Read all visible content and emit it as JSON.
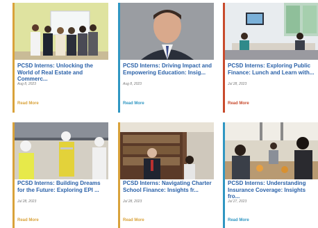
{
  "cards": [
    {
      "title": "PCSD Interns: Unlocking the World of Real Estate and Commerc...",
      "date": "Aug 8, 2023",
      "read_more": "Read More",
      "accent": "#d9a23a"
    },
    {
      "title": "PCSD Interns: Driving Impact and Empowering Education: Insig...",
      "date": "Aug 8, 2023",
      "read_more": "Read More",
      "accent": "#2f96c2"
    },
    {
      "title": "PCSD Interns: Exploring Public Finance: Lunch and Learn with...",
      "date": "Jul 28, 2023",
      "read_more": "Read More",
      "accent": "#c84a2c"
    },
    {
      "title": "PCSD Interns: Building Dreams for the Future: Exploring EPI ...",
      "date": "Jul 28, 2023",
      "read_more": "Read More",
      "accent": "#d9a23a"
    },
    {
      "title": "PCSD Interns: Navigating Charter School Finance: Insights fr...",
      "date": "Jul 28, 2023",
      "read_more": "Read More",
      "accent": "#d9a23a"
    },
    {
      "title": "PCSD Interns: Understanding Insurance Coverage: Insights fro...",
      "date": "Jul 27, 2023",
      "read_more": "Read More",
      "accent": "#2f96c2"
    }
  ]
}
